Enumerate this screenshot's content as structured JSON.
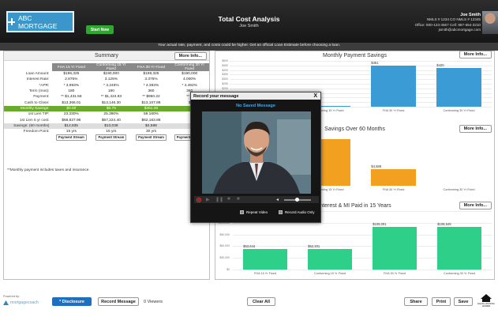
{
  "header": {
    "logo_text": "ABC MORTGAGE",
    "start_now": "Start Now",
    "title": "Total Cost Analysis",
    "subtitle": "Joe Smith",
    "contact_name": "Joe Smith",
    "contact_line1": "NMLS # 1234   CO NMLS # 12345",
    "contact_line2": "Office: 800-123-4567  Cell: 987-654-3210",
    "contact_line3": "jsmith@abcmortgage.com"
  },
  "disclaimer": "Your actual rate, payment, and costs could be higher. Get an official Loan Estimate before choosing a loan.",
  "summary": {
    "title": "Summary",
    "more_info": "More Info...",
    "columns": [
      "FHA 15 Yr Fixed",
      "Conforming 15 Yr Fixed",
      "FHA 30 Yr Fixed",
      "Conforming 30 Yr Fixed"
    ],
    "rows": [
      {
        "label": "Loan Amount:",
        "values": [
          "$196,325",
          "$190,000",
          "$199,325",
          "$190,000"
        ]
      },
      {
        "label": "Interest Rate:",
        "values": [
          "2.875%",
          "3.125%",
          "3.375%",
          "4.000%"
        ]
      },
      {
        "label": "*APR:",
        "values": [
          "* 3.993%",
          "* 3.245%",
          "* 4.383%",
          "* 4.492%"
        ]
      },
      {
        "label": "Term (mos):",
        "values": [
          "180",
          "180",
          "360",
          "360"
        ]
      },
      {
        "label": "Payment:",
        "values": [
          "** $1,431.58",
          "** $1,424.83",
          "** $960.22",
          "** $"
        ]
      },
      {
        "label": "Cash to Close:",
        "values": [
          "$13,366.01",
          "$13,146.30",
          "$13,107.89",
          "$"
        ]
      },
      {
        "label": "Monthly Savings:",
        "values": [
          "$0.00",
          "$6.75",
          "$451.36",
          ""
        ]
      },
      {
        "label": "1st Lien TIP:",
        "values": [
          "23.230%",
          "25.390%",
          "59.160%",
          ""
        ]
      },
      {
        "label": "1st Lien 5 yr cost:",
        "values": [
          "$68,827.96",
          "$67,224.40",
          "$62,163.88",
          ""
        ]
      },
      {
        "label": "Savings: (60 months)",
        "values": [
          "$12,835",
          "$13,038",
          "$4,588",
          ""
        ]
      },
      {
        "label": "Freedom Point:",
        "values": [
          "15 yrs",
          "15 yrs",
          "30 yrs",
          ""
        ]
      }
    ],
    "payment_stream": "Payment Stream",
    "note": "**Monthly payment includes taxes and insurance."
  },
  "charts": {
    "more_info": "More Info...",
    "chart1_title": "Monthly Payment Savings",
    "chart2_title": "Savings Over 60 Months",
    "chart3_title": "Interest & MI Paid in 15 Years"
  },
  "chart_data": [
    {
      "type": "bar",
      "title": "Monthly Payment Savings",
      "categories": [
        "FHA 15 Yr Fixed",
        "Conforming 15 Yr Fixed",
        "FHA 30 Yr Fixed",
        "Conforming 30 Yr Fixed"
      ],
      "values": [
        0,
        7,
        451,
        420
      ],
      "labels": [
        "",
        "",
        "$451",
        "$420"
      ],
      "yticks": [
        "$500",
        "$450",
        "$400",
        "$350",
        "$300",
        "$250",
        "$200",
        "$150",
        "$100",
        "$50",
        "$0"
      ],
      "ylim": [
        0,
        500
      ],
      "color": "#3a9bd5"
    },
    {
      "type": "bar",
      "title": "Savings Over 60 Months",
      "categories": [
        "FHA 15 Yr Fixed",
        "Conforming 15 Yr Fixed",
        "FHA 30 Yr Fixed",
        "Conforming 30 Yr Fixed"
      ],
      "values": [
        12835,
        13038,
        4588,
        0
      ],
      "labels": [
        "",
        "",
        "$4,588",
        ""
      ],
      "ylim": [
        0,
        16000
      ],
      "color": "#f2a020"
    },
    {
      "type": "bar",
      "title": "Interest & MI Paid in 15 Years",
      "categories": [
        "FHA 15 Yr Fixed",
        "Conforming 15 Yr Fixed",
        "FHA 30 Yr Fixed",
        "Conforming 30 Yr Fixed"
      ],
      "values": [
        53644,
        52201,
        109001,
        108549
      ],
      "labels": [
        "$53,644",
        "$52,201",
        "$109,001",
        "$108,549"
      ],
      "yticks": [
        "$150,000",
        "$120,000",
        "$90,000",
        "$60,000",
        "$30,000",
        "$0"
      ],
      "ylim": [
        0,
        150000
      ],
      "color": "#2ecf88"
    }
  ],
  "popup": {
    "title": "Record your message",
    "close": "X",
    "saved_message": "No Saved Message",
    "repeat_video": "Repeat Video",
    "record_audio_only": "Record Audio Only"
  },
  "footer": {
    "powered_by": "Powered by:",
    "brand": "mortgagecoach",
    "disclosure": "* Disclosure",
    "record_message": "Record Message",
    "viewers": "0 Viewers",
    "clear_all": "Clear All",
    "share": "Share",
    "print": "Print",
    "save": "Save",
    "equal_housing": "EQUAL HOUSING LENDER"
  }
}
